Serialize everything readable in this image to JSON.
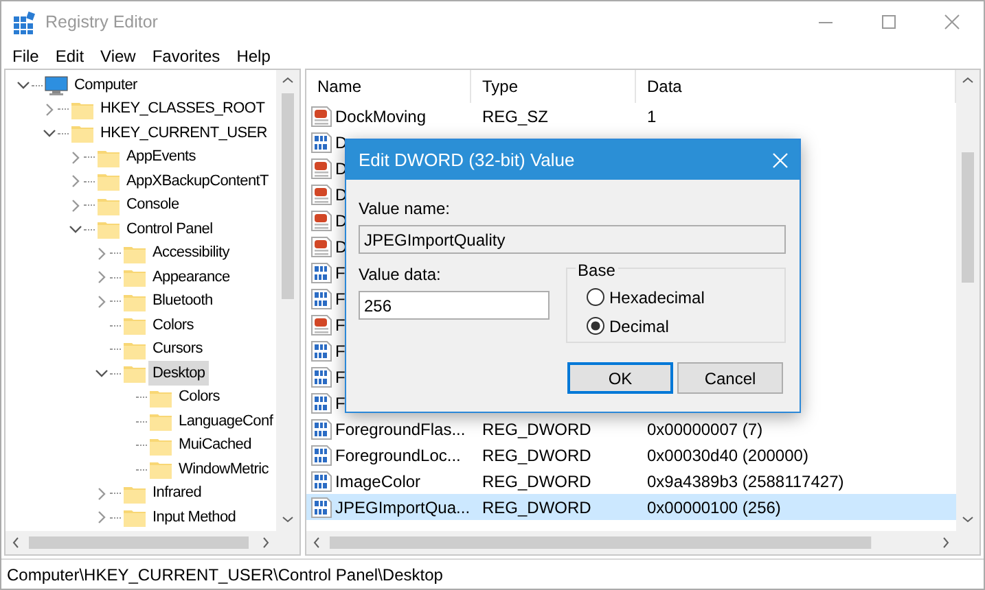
{
  "window": {
    "title": "Registry Editor"
  },
  "menu": [
    "File",
    "Edit",
    "View",
    "Favorites",
    "Help"
  ],
  "tree": [
    {
      "label": "Computer",
      "expanded": true,
      "selected": false,
      "children": [
        {
          "label": "HKEY_CLASSES_ROOT",
          "expanded": false,
          "selected": false
        },
        {
          "label": "HKEY_CURRENT_USER",
          "expanded": true,
          "selected": false,
          "children": [
            {
              "label": "AppEvents",
              "expanded": false,
              "selected": false
            },
            {
              "label": "AppXBackupContentT",
              "expanded": false,
              "selected": false
            },
            {
              "label": "Console",
              "expanded": false,
              "selected": false
            },
            {
              "label": "Control Panel",
              "expanded": true,
              "selected": false,
              "children": [
                {
                  "label": "Accessibility",
                  "expanded": false,
                  "selected": false
                },
                {
                  "label": "Appearance",
                  "expanded": false,
                  "selected": false
                },
                {
                  "label": "Bluetooth",
                  "expanded": false,
                  "selected": false
                },
                {
                  "label": "Colors",
                  "selected": false
                },
                {
                  "label": "Cursors",
                  "selected": false
                },
                {
                  "label": "Desktop",
                  "expanded": true,
                  "selected": true,
                  "children": [
                    {
                      "label": "Colors",
                      "selected": false
                    },
                    {
                      "label": "LanguageConf",
                      "selected": false
                    },
                    {
                      "label": "MuiCached",
                      "selected": false
                    },
                    {
                      "label": "WindowMetric",
                      "selected": false
                    }
                  ]
                },
                {
                  "label": "Infrared",
                  "expanded": false,
                  "selected": false
                },
                {
                  "label": "Input Method",
                  "expanded": false,
                  "selected": false
                }
              ]
            }
          ]
        }
      ]
    }
  ],
  "columns": [
    "Name",
    "Type",
    "Data"
  ],
  "rows": [
    {
      "kind": "sz",
      "name": "DockMoving",
      "type": "REG_SZ",
      "data": "1",
      "selected": false
    },
    {
      "kind": "dword",
      "name": "D",
      "selected": false
    },
    {
      "kind": "sz",
      "name": "D",
      "selected": false
    },
    {
      "kind": "sz",
      "name": "D",
      "selected": false
    },
    {
      "kind": "sz",
      "name": "D",
      "selected": false
    },
    {
      "kind": "sz",
      "name": "D",
      "selected": false
    },
    {
      "kind": "dword",
      "name": "F",
      "selected": false
    },
    {
      "kind": "dword",
      "name": "F",
      "selected": false
    },
    {
      "kind": "sz",
      "name": "F",
      "selected": false
    },
    {
      "kind": "dword",
      "name": "F",
      "selected": false
    },
    {
      "kind": "dword",
      "name": "F",
      "selected": false
    },
    {
      "kind": "dword",
      "name": "F",
      "selected": false
    },
    {
      "kind": "dword",
      "name": "ForegroundFlas...",
      "type": "REG_DWORD",
      "data": "0x00000007 (7)",
      "selected": false
    },
    {
      "kind": "dword",
      "name": "ForegroundLoc...",
      "type": "REG_DWORD",
      "data": "0x00030d40 (200000)",
      "selected": false
    },
    {
      "kind": "dword",
      "name": "ImageColor",
      "type": "REG_DWORD",
      "data": "0x9a4389b3 (2588117427)",
      "selected": false
    },
    {
      "kind": "dword",
      "name": "JPEGImportQua...",
      "type": "REG_DWORD",
      "data": "0x00000100 (256)",
      "selected": true
    }
  ],
  "dialog": {
    "title": "Edit DWORD (32-bit) Value",
    "value_name_label": "Value name:",
    "value_name": "JPEGImportQuality",
    "value_data_label": "Value data:",
    "value_data": "256",
    "base_label": "Base",
    "radios": [
      {
        "label": "Hexadecimal",
        "selected": false
      },
      {
        "label": "Decimal",
        "selected": true
      }
    ],
    "buttons": [
      {
        "label": "OK",
        "default": true
      },
      {
        "label": "Cancel",
        "default": false
      }
    ]
  },
  "status_bar": "Computer\\HKEY_CURRENT_USER\\Control Panel\\Desktop"
}
